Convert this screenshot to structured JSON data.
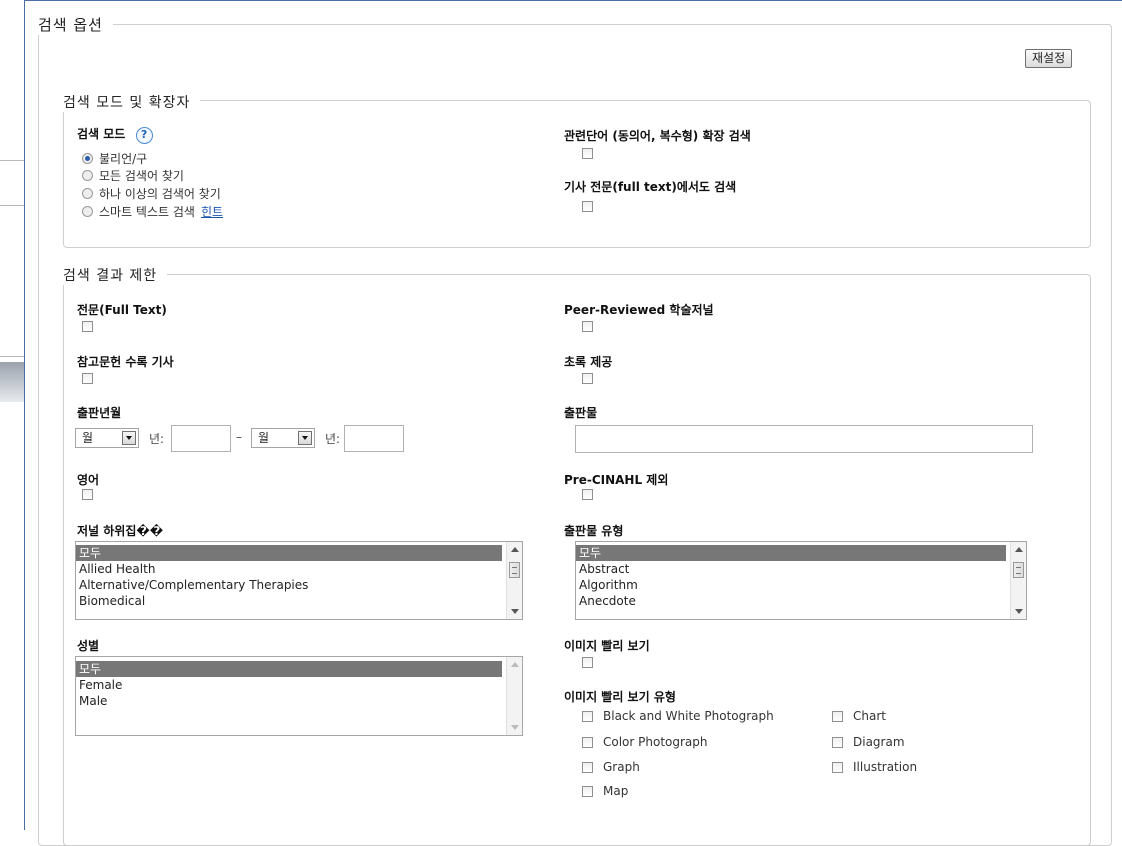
{
  "search_options": {
    "title": "검색 옵션",
    "reset_label": "재설정"
  },
  "search_modes": {
    "title": "검색 모드 및 확장자",
    "mode_label": "검색 모드",
    "help_glyph": "?",
    "modes": [
      "불리언/구",
      "모든 검색어 찾기",
      "하나 이상의 검색어 찾기",
      "스마트 텍스트 검색"
    ],
    "selected_mode": "불리언/구",
    "hint_label": "힌트",
    "related_words_label": "관련단어 (동의어, 복수형) 확장 검색",
    "full_text_search_label": "기사 전문(full text)에서도 검색"
  },
  "limits": {
    "title": "검색 결과 제한",
    "full_text_label": "전문(Full Text)",
    "peer_reviewed_label": "Peer-Reviewed 학술저널",
    "references_label": "참고문헌 수록 기사",
    "abstract_label": "초록 제공",
    "pub_date_label": "출판년월",
    "month_from": "월",
    "year_label": "년:",
    "dash": "–",
    "month_to": "월",
    "publication_label": "출판물",
    "publication_value": "",
    "english_label": "영어",
    "pre_cinahl_label": "Pre-CINAHL 제외",
    "journal_subset_label": "저널 하위집��",
    "journal_subset_options": [
      "모두",
      "Allied Health",
      "Alternative/Complementary Therapies",
      "Biomedical"
    ],
    "publication_type_label": "출판물 유형",
    "publication_type_options": [
      "모두",
      "Abstract",
      "Algorithm",
      "Anecdote"
    ],
    "gender_label": "성별",
    "gender_options": [
      "모두",
      "Female",
      "Male"
    ],
    "image_quick_view_label": "이미지 빨리 보기",
    "image_quick_view_types_label": "이미지 빨리 보기 유형",
    "image_types": [
      "Black and White Photograph",
      "Chart",
      "Color Photograph",
      "Diagram",
      "Graph",
      "Illustration",
      "Map"
    ]
  },
  "icons": {
    "help": "help-icon",
    "dropdown": "chevron-down-icon",
    "scroll_up": "scroll-up-icon",
    "scroll_down": "scroll-down-icon"
  },
  "colors": {
    "border_accent": "#4a6fa5",
    "link": "#1a56b0",
    "selected_option": "#777777"
  }
}
